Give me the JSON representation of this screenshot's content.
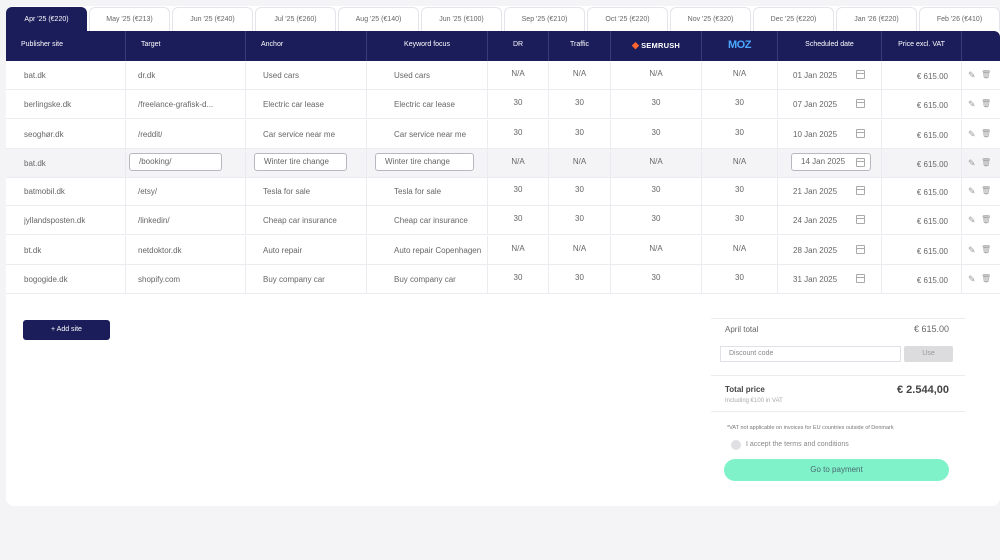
{
  "tabs": [
    {
      "label": "Apr '25 (€220)"
    },
    {
      "label": "May '25 (€213)"
    },
    {
      "label": "Jun '25 (€240)"
    },
    {
      "label": "Jul '25 (€260)"
    },
    {
      "label": "Aug '25 (€140)"
    },
    {
      "label": "Jun '25 (€100)"
    },
    {
      "label": "Sep '25 (€210)"
    },
    {
      "label": "Oct '25 (€220)"
    },
    {
      "label": "Nov '25 (€320)"
    },
    {
      "label": "Dec '25 (€220)"
    },
    {
      "label": "Jan '26 (€220)"
    },
    {
      "label": "Feb '26 (€410)"
    }
  ],
  "columns": {
    "publisher": "Publisher site",
    "target": "Target",
    "anchor": "Anchor",
    "keyword": "Keyword focus",
    "dr": "DR",
    "traffic": "Traffic",
    "semrush_mark": "◆",
    "semrush": "SEMRUSH",
    "moz": "MOZ",
    "date": "Scheduled date",
    "price": "Price excl. VAT"
  },
  "rows": [
    {
      "publisher": "bat.dk",
      "target": "dr.dk",
      "anchor": "Used cars",
      "keyword": "Used cars",
      "dr": "N/A",
      "traffic": "N/A",
      "semrush": "N/A",
      "moz": "N/A",
      "date": "01 Jan 2025",
      "price": "€ 615.00"
    },
    {
      "publisher": "berlingske.dk",
      "target": "/freelance-grafisk-d...",
      "anchor": "Electric car lease",
      "keyword": "Electric car lease",
      "dr": "30",
      "traffic": "30",
      "semrush": "30",
      "moz": "30",
      "date": "07 Jan 2025",
      "price": "€ 615.00"
    },
    {
      "publisher": "seoghør.dk",
      "target": "/reddit/",
      "anchor": "Car service near me",
      "keyword": "Car service near me",
      "dr": "30",
      "traffic": "30",
      "semrush": "30",
      "moz": "30",
      "date": "10 Jan 2025",
      "price": "€ 615.00"
    },
    {
      "publisher": "bat.dk",
      "target": "/booking/",
      "anchor": "Winter tire change",
      "keyword": "Winter tire change",
      "dr": "N/A",
      "traffic": "N/A",
      "semrush": "N/A",
      "moz": "N/A",
      "date": "14 Jan 2025",
      "price": "€ 615.00"
    },
    {
      "publisher": "batmobil.dk",
      "target": "/etsy/",
      "anchor": "Tesla for sale",
      "keyword": "Tesla for sale",
      "dr": "30",
      "traffic": "30",
      "semrush": "30",
      "moz": "30",
      "date": "21 Jan 2025",
      "price": "€ 615.00"
    },
    {
      "publisher": "jyllandsposten.dk",
      "target": "/linkedin/",
      "anchor": "Cheap car insurance",
      "keyword": "Cheap car insurance",
      "dr": "30",
      "traffic": "30",
      "semrush": "30",
      "moz": "30",
      "date": "24 Jan 2025",
      "price": "€ 615.00"
    },
    {
      "publisher": "bt.dk",
      "target": "netdoktor.dk",
      "anchor": "Auto repair",
      "keyword": "Auto repair Copenhagen",
      "dr": "N/A",
      "traffic": "N/A",
      "semrush": "N/A",
      "moz": "N/A",
      "date": "28 Jan 2025",
      "price": "€ 615.00"
    },
    {
      "publisher": "bogogide.dk",
      "target": "shopify.com",
      "anchor": "Buy company car",
      "keyword": "Buy company car",
      "dr": "30",
      "traffic": "30",
      "semrush": "30",
      "moz": "30",
      "date": "31 Jan 2025",
      "price": "€ 615.00"
    }
  ],
  "icons": {
    "edit": "✎",
    "delete": "🗑"
  },
  "actions": {
    "add_site": "+ Add site"
  },
  "summary": {
    "month_total_label": "April total",
    "month_total_value": "€ 615.00",
    "discount_placeholder": "Discount code",
    "use_label": "Use",
    "total_label": "Total price",
    "total_value": "€ 2.544,00",
    "vat_note": "Including €100 in VAT",
    "disclaimer": "*VAT not applicable on invoices for EU countries outside of Denmark",
    "terms_label": "I accept the terms and conditions",
    "pay_label": "Go to payment"
  },
  "colors": {
    "primary": "#1b1d5a",
    "accent": "#7ff2ca",
    "semrush": "#ff642d",
    "moz": "#4aa8ff"
  }
}
